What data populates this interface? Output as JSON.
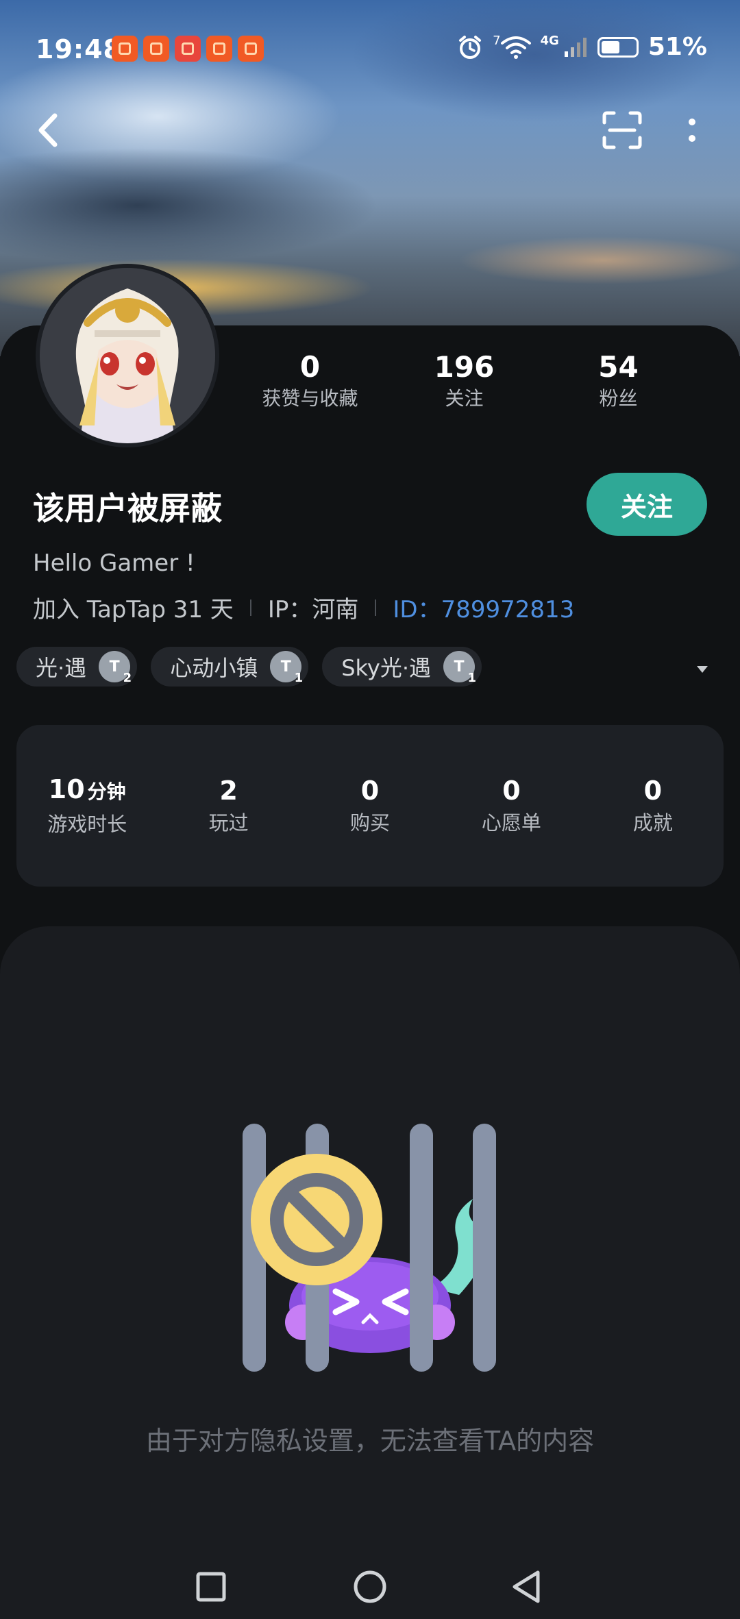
{
  "status_bar": {
    "time": "19:48",
    "network": "4G",
    "sim_slot": "7",
    "battery": "51%"
  },
  "profile": {
    "username": "该用户被屏蔽",
    "follow_label": "关注",
    "bio": "Hello Gamer !",
    "joined": "加入 TapTap 31 天",
    "ip": "IP：河南",
    "id": "ID：789972813",
    "stats": [
      {
        "value": "0",
        "label": "获赞与收藏"
      },
      {
        "value": "196",
        "label": "关注"
      },
      {
        "value": "54",
        "label": "粉丝"
      }
    ],
    "tags": [
      {
        "name": "光·遇",
        "badge": "T",
        "level": "2"
      },
      {
        "name": "心动小镇",
        "badge": "T",
        "level": "1"
      },
      {
        "name": "Sky光·遇",
        "badge": "T",
        "level": "1"
      }
    ]
  },
  "game_stats": [
    {
      "value": "10",
      "unit": "分钟",
      "label": "游戏时长"
    },
    {
      "value": "2",
      "unit": "",
      "label": "玩过"
    },
    {
      "value": "0",
      "unit": "",
      "label": "购买"
    },
    {
      "value": "0",
      "unit": "",
      "label": "心愿单"
    },
    {
      "value": "0",
      "unit": "",
      "label": "成就"
    }
  ],
  "privacy_message": "由于对方隐私设置，无法查看TA的内容",
  "icons": {
    "back": "chevron-left-icon",
    "scan": "scan-icon",
    "more": "more-vertical-icon",
    "nav_recent": "square-icon",
    "nav_home": "circle-icon",
    "nav_back": "triangle-back-icon"
  },
  "colors": {
    "accent": "#2fa896",
    "id_link": "#4f8fe0",
    "background": "#101214"
  }
}
